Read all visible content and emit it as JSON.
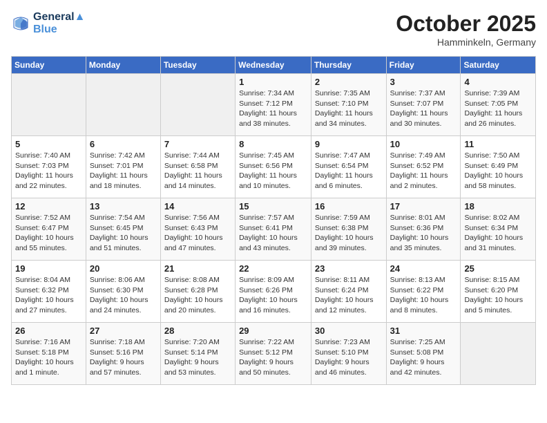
{
  "header": {
    "logo_line1": "General",
    "logo_line2": "Blue",
    "month": "October 2025",
    "location": "Hamminkeln, Germany"
  },
  "days_of_week": [
    "Sunday",
    "Monday",
    "Tuesday",
    "Wednesday",
    "Thursday",
    "Friday",
    "Saturday"
  ],
  "weeks": [
    [
      {
        "day": "",
        "info": ""
      },
      {
        "day": "",
        "info": ""
      },
      {
        "day": "",
        "info": ""
      },
      {
        "day": "1",
        "info": "Sunrise: 7:34 AM\nSunset: 7:12 PM\nDaylight: 11 hours\nand 38 minutes."
      },
      {
        "day": "2",
        "info": "Sunrise: 7:35 AM\nSunset: 7:10 PM\nDaylight: 11 hours\nand 34 minutes."
      },
      {
        "day": "3",
        "info": "Sunrise: 7:37 AM\nSunset: 7:07 PM\nDaylight: 11 hours\nand 30 minutes."
      },
      {
        "day": "4",
        "info": "Sunrise: 7:39 AM\nSunset: 7:05 PM\nDaylight: 11 hours\nand 26 minutes."
      }
    ],
    [
      {
        "day": "5",
        "info": "Sunrise: 7:40 AM\nSunset: 7:03 PM\nDaylight: 11 hours\nand 22 minutes."
      },
      {
        "day": "6",
        "info": "Sunrise: 7:42 AM\nSunset: 7:01 PM\nDaylight: 11 hours\nand 18 minutes."
      },
      {
        "day": "7",
        "info": "Sunrise: 7:44 AM\nSunset: 6:58 PM\nDaylight: 11 hours\nand 14 minutes."
      },
      {
        "day": "8",
        "info": "Sunrise: 7:45 AM\nSunset: 6:56 PM\nDaylight: 11 hours\nand 10 minutes."
      },
      {
        "day": "9",
        "info": "Sunrise: 7:47 AM\nSunset: 6:54 PM\nDaylight: 11 hours\nand 6 minutes."
      },
      {
        "day": "10",
        "info": "Sunrise: 7:49 AM\nSunset: 6:52 PM\nDaylight: 11 hours\nand 2 minutes."
      },
      {
        "day": "11",
        "info": "Sunrise: 7:50 AM\nSunset: 6:49 PM\nDaylight: 10 hours\nand 58 minutes."
      }
    ],
    [
      {
        "day": "12",
        "info": "Sunrise: 7:52 AM\nSunset: 6:47 PM\nDaylight: 10 hours\nand 55 minutes."
      },
      {
        "day": "13",
        "info": "Sunrise: 7:54 AM\nSunset: 6:45 PM\nDaylight: 10 hours\nand 51 minutes."
      },
      {
        "day": "14",
        "info": "Sunrise: 7:56 AM\nSunset: 6:43 PM\nDaylight: 10 hours\nand 47 minutes."
      },
      {
        "day": "15",
        "info": "Sunrise: 7:57 AM\nSunset: 6:41 PM\nDaylight: 10 hours\nand 43 minutes."
      },
      {
        "day": "16",
        "info": "Sunrise: 7:59 AM\nSunset: 6:38 PM\nDaylight: 10 hours\nand 39 minutes."
      },
      {
        "day": "17",
        "info": "Sunrise: 8:01 AM\nSunset: 6:36 PM\nDaylight: 10 hours\nand 35 minutes."
      },
      {
        "day": "18",
        "info": "Sunrise: 8:02 AM\nSunset: 6:34 PM\nDaylight: 10 hours\nand 31 minutes."
      }
    ],
    [
      {
        "day": "19",
        "info": "Sunrise: 8:04 AM\nSunset: 6:32 PM\nDaylight: 10 hours\nand 27 minutes."
      },
      {
        "day": "20",
        "info": "Sunrise: 8:06 AM\nSunset: 6:30 PM\nDaylight: 10 hours\nand 24 minutes."
      },
      {
        "day": "21",
        "info": "Sunrise: 8:08 AM\nSunset: 6:28 PM\nDaylight: 10 hours\nand 20 minutes."
      },
      {
        "day": "22",
        "info": "Sunrise: 8:09 AM\nSunset: 6:26 PM\nDaylight: 10 hours\nand 16 minutes."
      },
      {
        "day": "23",
        "info": "Sunrise: 8:11 AM\nSunset: 6:24 PM\nDaylight: 10 hours\nand 12 minutes."
      },
      {
        "day": "24",
        "info": "Sunrise: 8:13 AM\nSunset: 6:22 PM\nDaylight: 10 hours\nand 8 minutes."
      },
      {
        "day": "25",
        "info": "Sunrise: 8:15 AM\nSunset: 6:20 PM\nDaylight: 10 hours\nand 5 minutes."
      }
    ],
    [
      {
        "day": "26",
        "info": "Sunrise: 7:16 AM\nSunset: 5:18 PM\nDaylight: 10 hours\nand 1 minute."
      },
      {
        "day": "27",
        "info": "Sunrise: 7:18 AM\nSunset: 5:16 PM\nDaylight: 9 hours\nand 57 minutes."
      },
      {
        "day": "28",
        "info": "Sunrise: 7:20 AM\nSunset: 5:14 PM\nDaylight: 9 hours\nand 53 minutes."
      },
      {
        "day": "29",
        "info": "Sunrise: 7:22 AM\nSunset: 5:12 PM\nDaylight: 9 hours\nand 50 minutes."
      },
      {
        "day": "30",
        "info": "Sunrise: 7:23 AM\nSunset: 5:10 PM\nDaylight: 9 hours\nand 46 minutes."
      },
      {
        "day": "31",
        "info": "Sunrise: 7:25 AM\nSunset: 5:08 PM\nDaylight: 9 hours\nand 42 minutes."
      },
      {
        "day": "",
        "info": ""
      }
    ]
  ]
}
